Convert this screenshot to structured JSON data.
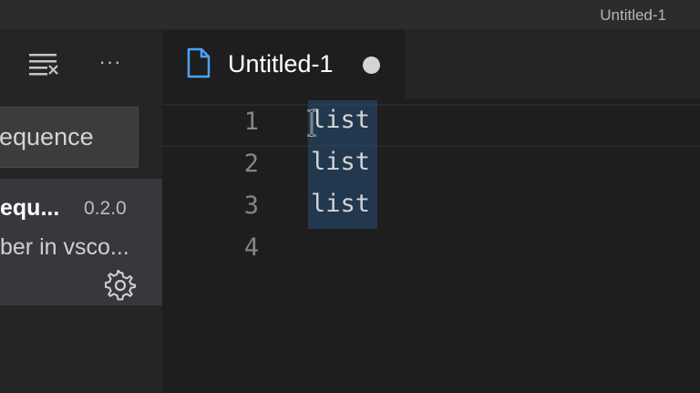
{
  "window": {
    "title": "Untitled-1"
  },
  "sidebar": {
    "search_value": "equence",
    "extension": {
      "name": "equ...",
      "version": "0.2.0",
      "description": "ber in vsco..."
    }
  },
  "editor": {
    "tab_label": "Untitled-1",
    "lines": [
      {
        "number": "1",
        "text": "list"
      },
      {
        "number": "2",
        "text": "list"
      },
      {
        "number": "3",
        "text": "list"
      },
      {
        "number": "4",
        "text": ""
      }
    ]
  },
  "icons": {
    "clear": "clear-all-icon",
    "more": "more-actions-icon",
    "gear": "gear-icon",
    "file": "file-icon",
    "dirty": "unsaved-dot-icon"
  },
  "colors": {
    "editor_bg": "#1e1e1e",
    "sidebar_bg": "#252526",
    "selection": "#264f78",
    "file_icon": "#4aa3ff"
  }
}
